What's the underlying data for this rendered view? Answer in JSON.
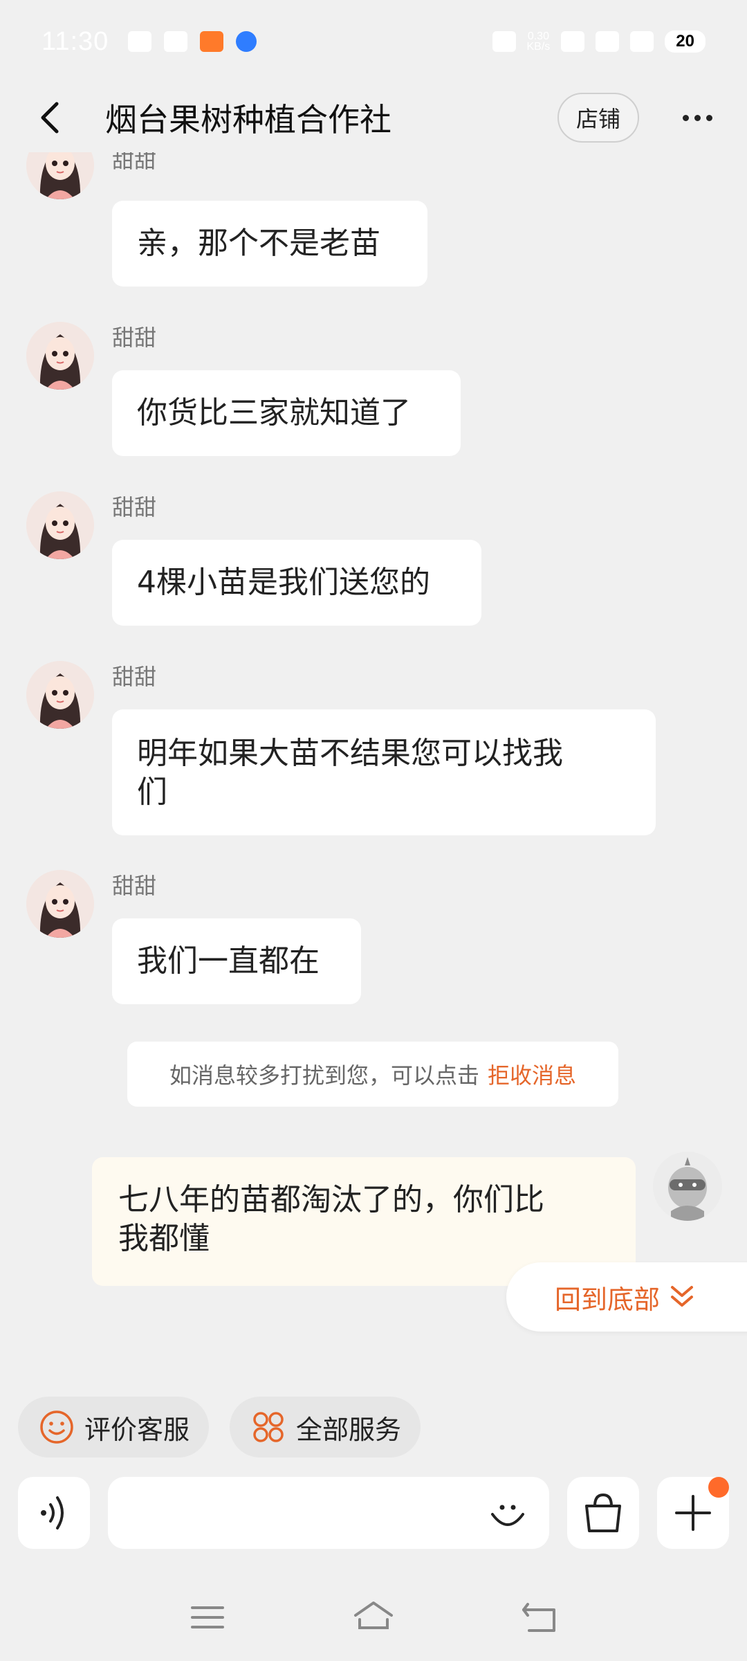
{
  "status_bar": {
    "time": "11:30",
    "net_speed_value": "0.30",
    "net_speed_unit": "KB/s",
    "battery": "20"
  },
  "header": {
    "title": "烟台果树种植合作社",
    "shop_button": "店铺"
  },
  "messages": [
    {
      "sender": "甜甜",
      "text": "亲，那个不是老苗"
    },
    {
      "sender": "甜甜",
      "text": "你货比三家就知道了"
    },
    {
      "sender": "甜甜",
      "text": "4棵小苗是我们送您的"
    },
    {
      "sender": "甜甜",
      "text_line1": "明年如果大苗不结果您可以找我",
      "text_line2": "们"
    },
    {
      "sender": "甜甜",
      "text": "我们一直都在"
    }
  ],
  "notice": {
    "text": "如消息较多打扰到您，可以点击",
    "link": "拒收消息"
  },
  "own_message": {
    "line1": "七八年的苗都淘汰了的，你们比",
    "line2": "我都懂"
  },
  "jump_to_bottom": "回到底部",
  "quick_actions": {
    "rate_service": "评价客服",
    "all_services": "全部服务"
  },
  "input": {
    "placeholder": ""
  },
  "colors": {
    "accent": "#e5662a",
    "background": "#f0f0f0",
    "own_bubble": "#fefaf0",
    "badge": "#ff6a2a"
  },
  "icons": [
    "back-arrow-icon",
    "more-dots-icon",
    "smile-icon",
    "grid-services-icon",
    "voice-icon",
    "emoji-icon",
    "bag-icon",
    "plus-icon",
    "menu-icon",
    "home-icon",
    "back-icon"
  ]
}
